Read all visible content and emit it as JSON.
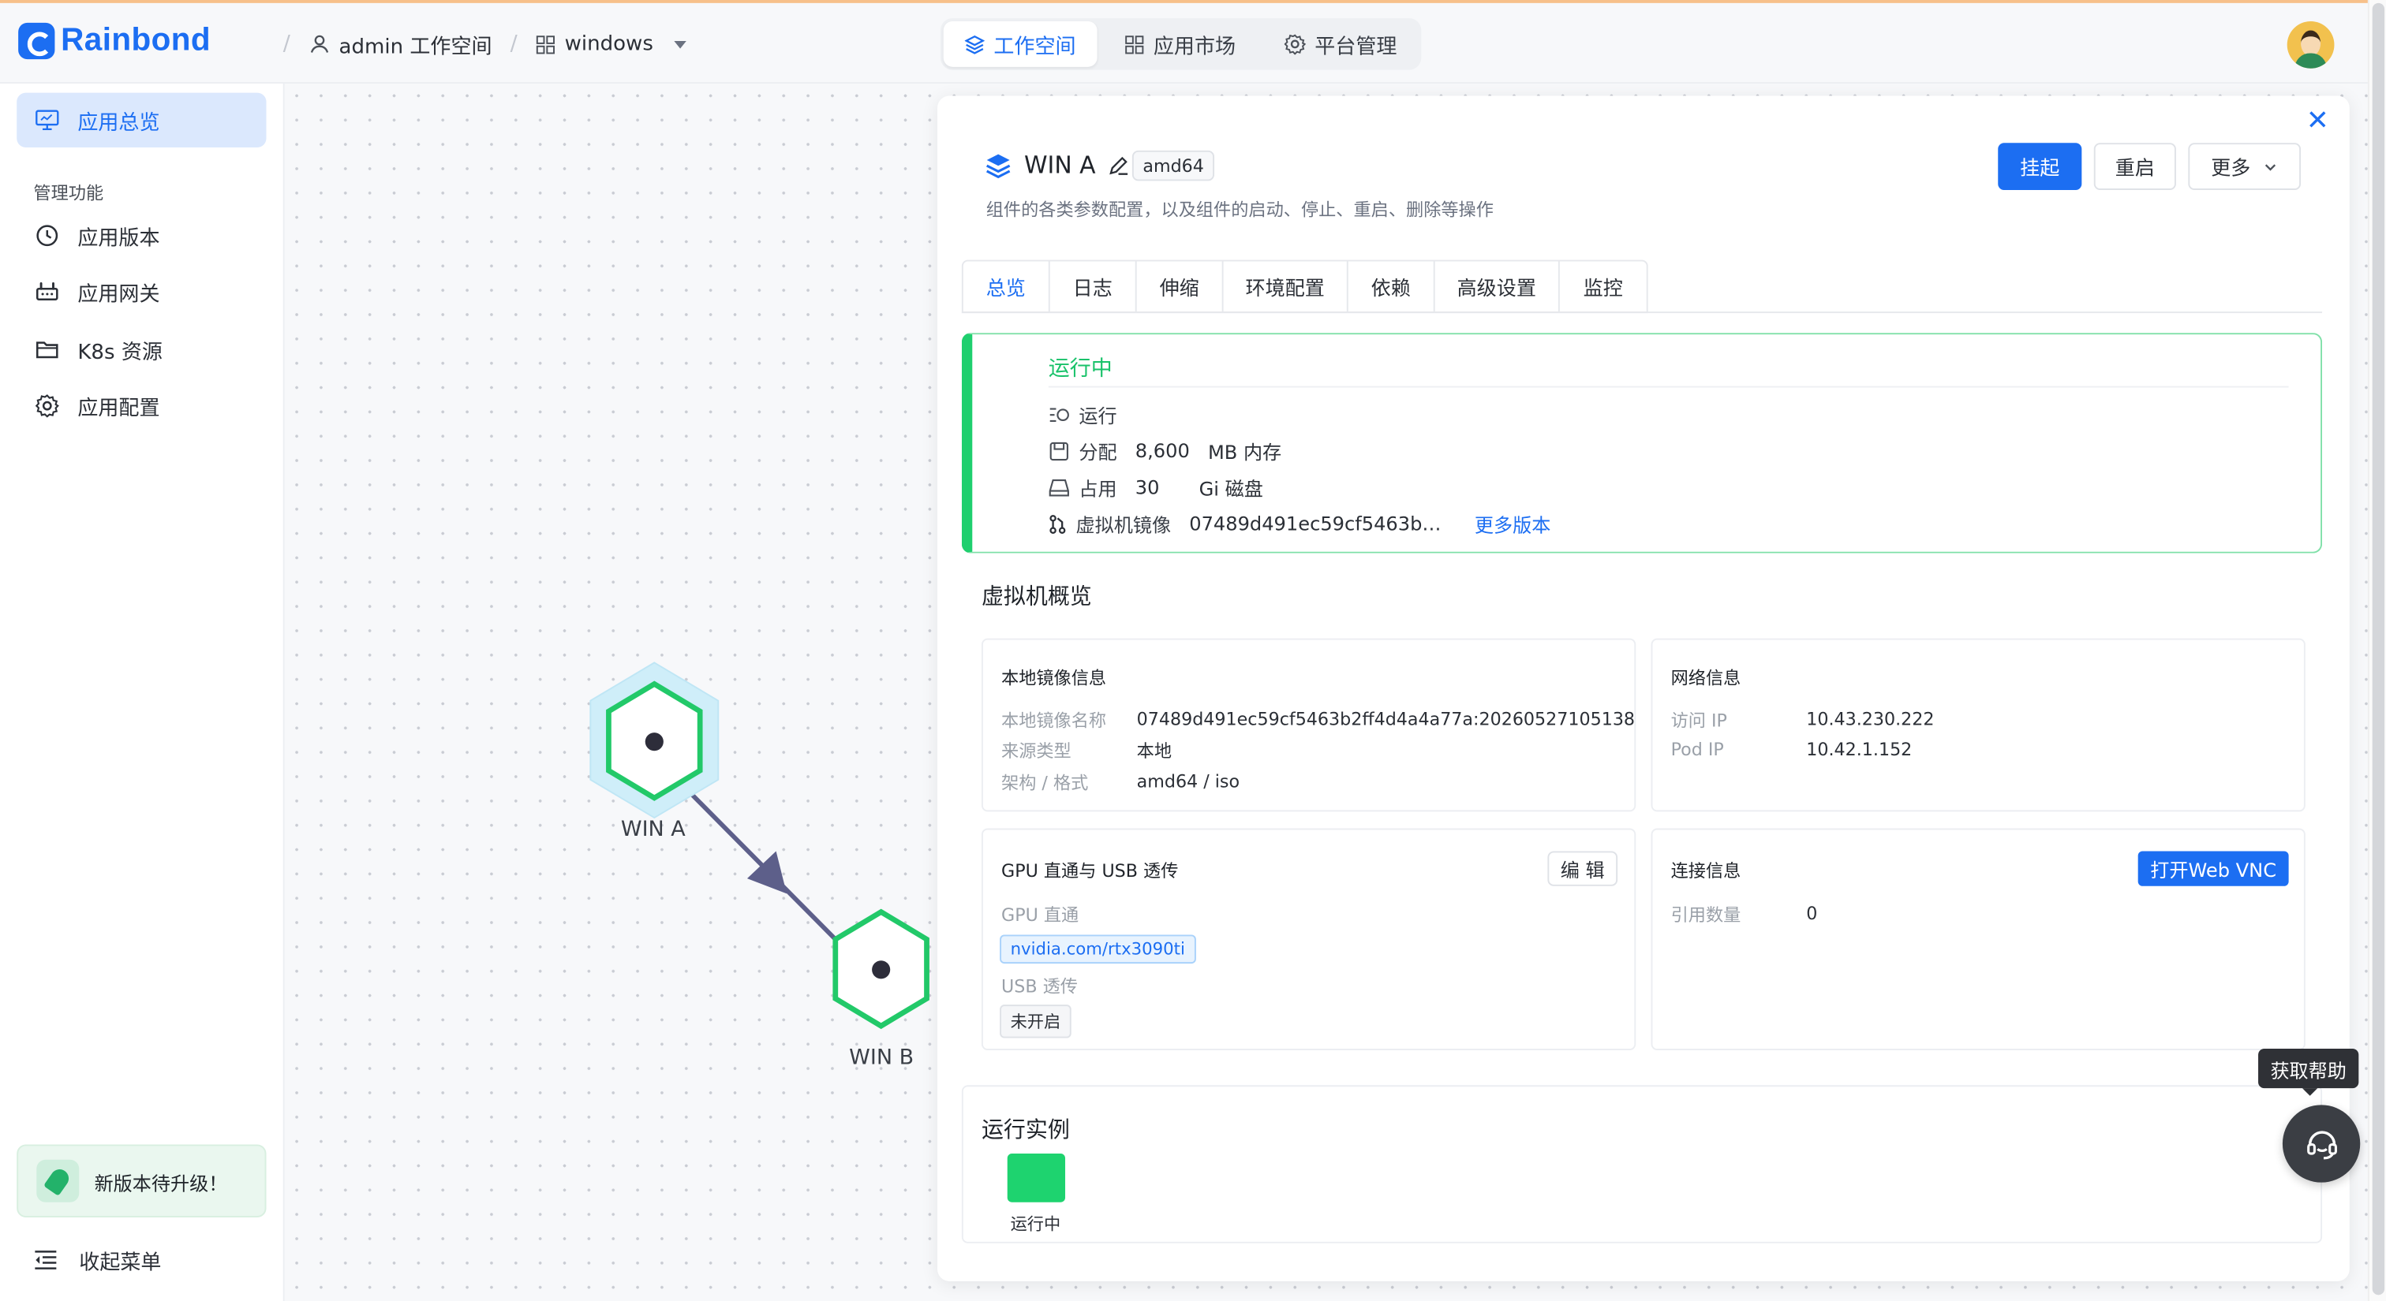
{
  "brand": {
    "name": "Rainbond"
  },
  "breadcrumb": {
    "workspace": "admin 工作空间",
    "app": "windows"
  },
  "main_nav": [
    {
      "label": "工作空间",
      "active": true
    },
    {
      "label": "应用市场",
      "active": false
    },
    {
      "label": "平台管理",
      "active": false
    }
  ],
  "sidebar": {
    "overview": "应用总览",
    "section_title": "管理功能",
    "items": [
      {
        "label": "应用版本",
        "icon": "clock-icon"
      },
      {
        "label": "应用网关",
        "icon": "gateway-icon"
      },
      {
        "label": "K8s 资源",
        "icon": "folder-icon"
      },
      {
        "label": "应用配置",
        "icon": "gear-icon"
      }
    ],
    "upgrade": "新版本待升级！",
    "collapse": "收起菜单"
  },
  "topology": {
    "nodes": [
      {
        "label": "WIN A"
      },
      {
        "label": "WIN B"
      }
    ]
  },
  "panel": {
    "title": "WIN A",
    "arch": "amd64",
    "subtitle": "组件的各类参数配置，以及组件的启动、停止、重启、删除等操作",
    "buttons": {
      "suspend": "挂起",
      "restart": "重启",
      "more": "更多"
    },
    "tabs": [
      "总览",
      "日志",
      "伸缩",
      "环境配置",
      "依赖",
      "高级设置",
      "监控"
    ],
    "status": {
      "title": "运行中",
      "run_label": "运行",
      "alloc_label": "分配",
      "alloc_value": "8,600",
      "alloc_unit": "MB 内存",
      "usage_label": "占用",
      "usage_value": "30",
      "usage_unit": "Gi 磁盘",
      "image_label": "虚拟机镜像",
      "image_value": "07489d491ec59cf5463b…",
      "more_versions": "更多版本"
    },
    "vm_overview_title": "虚拟机概览",
    "local_image": {
      "title": "本地镜像信息",
      "name_label": "本地镜像名称",
      "name_value": "07489d491ec59cf5463b2ff4d4a4a77a:20260527105138",
      "source_label": "来源类型",
      "source_value": "本地",
      "arch_label": "架构 / 格式",
      "arch_value": "amd64 / iso"
    },
    "network": {
      "title": "网络信息",
      "access_ip_label": "访问 IP",
      "access_ip_value": "10.43.230.222",
      "pod_ip_label": "Pod IP",
      "pod_ip_value": "10.42.1.152"
    },
    "gpu": {
      "title": "GPU 直通与 USB 透传",
      "edit": "编 辑",
      "gpu_label": "GPU 直通",
      "gpu_value": "nvidia.com/rtx3090ti",
      "usb_label": "USB 透传",
      "usb_value": "未开启"
    },
    "connection": {
      "title": "连接信息",
      "vnc_button": "打开Web VNC",
      "refs_label": "引用数量",
      "refs_value": "0"
    },
    "instances": {
      "title": "运行实例",
      "status": "运行中"
    }
  },
  "help": {
    "tooltip": "获取帮助"
  },
  "colors": {
    "accent": "#1c6ef2",
    "success": "#1fcf6e",
    "node_green": "#22c969"
  }
}
